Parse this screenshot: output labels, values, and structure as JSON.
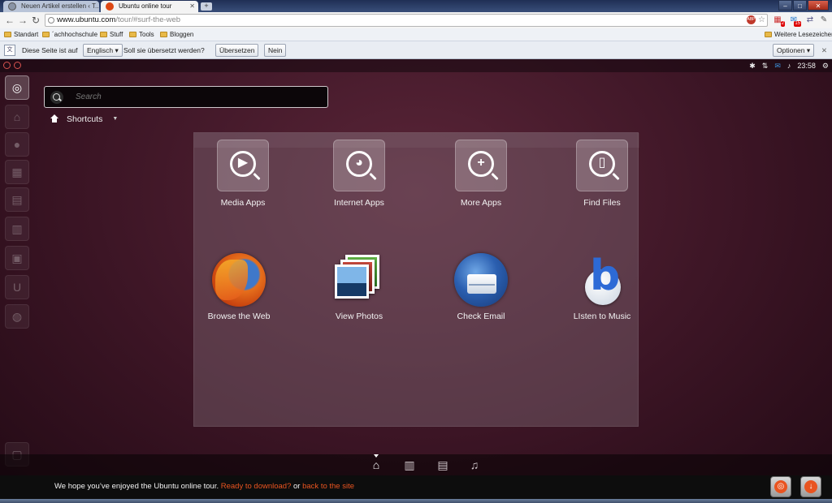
{
  "browser": {
    "tabs": [
      {
        "label": "Neuen Artikel erstellen ‹ T..."
      },
      {
        "label": "Ubuntu online tour"
      }
    ],
    "new_tab_symbol": "+",
    "window_controls": {
      "minimize": "–",
      "maximize": "□",
      "close": "✕"
    },
    "address": {
      "host": "www.ubuntu.com",
      "path": "/tour/#surf-the-web"
    },
    "toolbar_icons": [
      "abp-icon",
      "star-icon",
      "translate-icon",
      "feed-icon",
      "calendar-icon",
      "wrench-icon"
    ],
    "toolbar_badges": {
      "ext1": "2",
      "ext2": "15"
    },
    "bookmarks": [
      {
        "label": "Standart"
      },
      {
        "label": "´achhochschule"
      },
      {
        "label": "Stuff"
      },
      {
        "label": "Tools"
      },
      {
        "label": "Bloggen"
      }
    ],
    "other_bookmarks": "Weitere Lesezeichen",
    "translate_bar": {
      "prefix": "Diese Seite ist auf",
      "language": "Englisch",
      "question": "Soll sie übersetzt werden?",
      "translate_button": "Übersetzen",
      "no_button": "Nein",
      "options_button": "Optionen",
      "close": "✕"
    }
  },
  "ubuntu": {
    "panel": {
      "time": "23:58"
    },
    "search": {
      "placeholder": "Search"
    },
    "shortcuts_label": "Shortcuts",
    "categories": [
      {
        "label": "Media Apps",
        "icon": "play-icon"
      },
      {
        "label": "Internet Apps",
        "icon": "globe-icon"
      },
      {
        "label": "More Apps",
        "icon": "plus-icon"
      },
      {
        "label": "Find Files",
        "icon": "file-icon"
      }
    ],
    "apps": [
      {
        "label": "Browse the Web",
        "icon": "firefox-icon"
      },
      {
        "label": "View Photos",
        "icon": "photos-icon"
      },
      {
        "label": "Check Email",
        "icon": "thunderbird-icon"
      },
      {
        "label": "LIsten to Music",
        "icon": "banshee-icon"
      }
    ],
    "footer": {
      "message": "We hope you’ve enjoyed the Ubuntu online tour.",
      "download_link": "Ready to download?",
      "or": "or",
      "back_link": "back to the site"
    },
    "accent_color": "#e95420"
  }
}
